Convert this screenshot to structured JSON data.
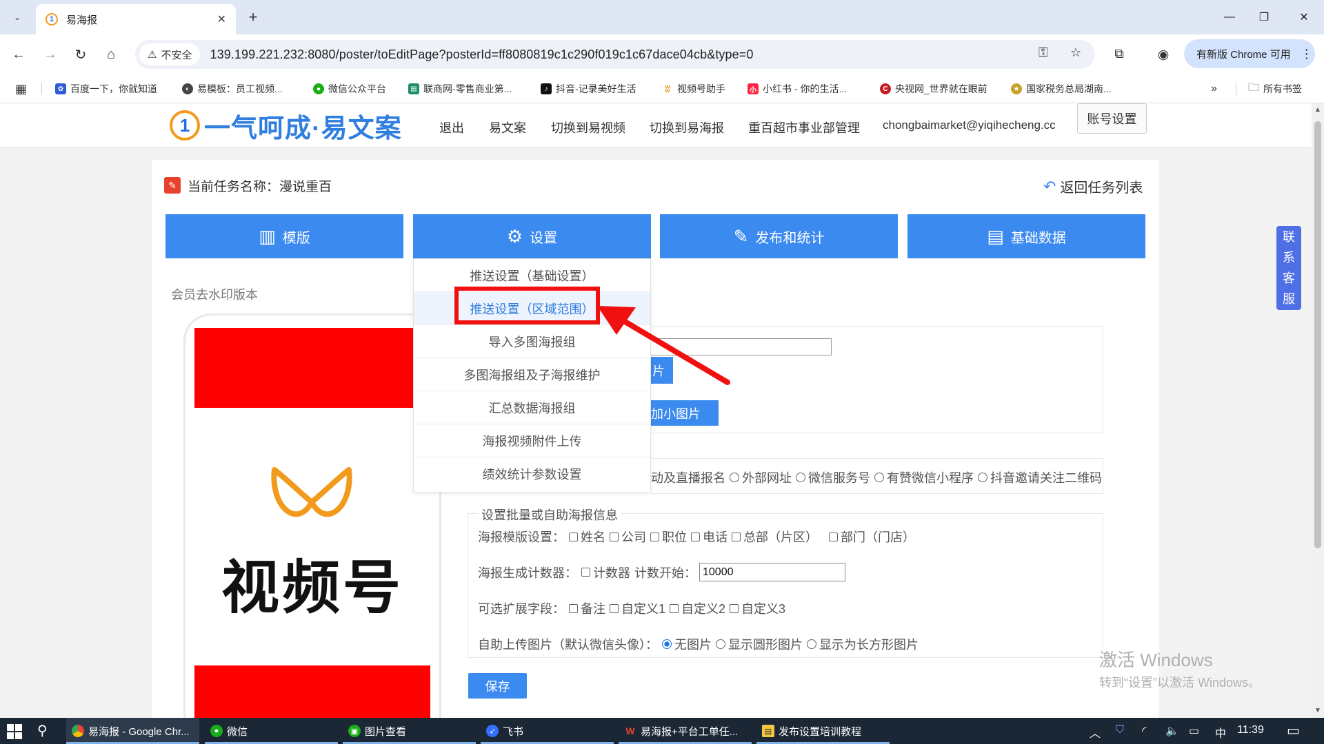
{
  "browser": {
    "tab_title": "易海报",
    "tab_favicon": "1",
    "url_security": "不安全",
    "url": "139.199.221.232:8080/poster/toEditPage?posterId=ff8080819c1c290f019c1c67dace04cb&type=0",
    "update_label": "有新版 Chrome 可用",
    "bookmarks": [
      {
        "label": "百度一下，你就知道",
        "color": "#2f5bd7",
        "icon": "paw-icon"
      },
      {
        "label": "易模板：员工视频...",
        "color": "#444",
        "icon": "globe-icon"
      },
      {
        "label": "微信公众平台",
        "color": "#1aad19",
        "icon": "wechat-icon"
      },
      {
        "label": "联商网-零售商业第...",
        "color": "#1c8c6a",
        "icon": "news-icon"
      },
      {
        "label": "抖音-记录美好生活",
        "color": "#111",
        "icon": "tiktok-icon"
      },
      {
        "label": "视频号助手",
        "color": "#f29a1c",
        "icon": "channels-icon"
      },
      {
        "label": "小红书 - 你的生活...",
        "color": "#ff2442",
        "icon": "xiaohongshu-icon"
      },
      {
        "label": "央视网_世界就在眼前",
        "color": "#c81d25",
        "icon": "cctv-icon"
      },
      {
        "label": "国家税务总局湖南...",
        "color": "#c8a02a",
        "icon": "emblem-icon"
      }
    ],
    "all_bookmarks": "所有书签"
  },
  "header": {
    "logo_text": "一气呵成·易文案",
    "nav": [
      "退出",
      "易文案",
      "切换到易视频",
      "切换到易海报",
      "重百超市事业部管理",
      "chongbaimarket@yiqihecheng.cc"
    ],
    "account_settings": "账号设置"
  },
  "task": {
    "label": "当前任务名称：漫说重百",
    "back": "返回任务列表"
  },
  "main_tabs": [
    {
      "label": "模版",
      "icon": "layout-icon"
    },
    {
      "label": "设置",
      "icon": "gear-icon"
    },
    {
      "label": "发布和统计",
      "icon": "edit-icon"
    },
    {
      "label": "基础数据",
      "icon": "data-icon"
    }
  ],
  "settings_menu": [
    "推送设置（基础设置）",
    "推送设置（区域范围）",
    "导入多图海报组",
    "多图海报组及子海报维护",
    "汇总数据海报组",
    "海报视频附件上传",
    "绩效统计参数设置"
  ],
  "member_note": "会员去水印版本",
  "poster": {
    "brand_text": "视频号",
    "accent": "#ff0000"
  },
  "form": {
    "partial_btn_a": "片",
    "partial_btn_b": "加小图片",
    "link_options": [
      "动及直播报名",
      "外部网址",
      "微信服务号",
      "有赞微信小程序",
      "抖音邀请关注二维码"
    ],
    "batch_legend": "设置批量或自助海报信息",
    "template_label": "海报模版设置：",
    "template_fields": [
      "姓名",
      "公司",
      "职位",
      "电话",
      "总部（片区）",
      "部门（门店）"
    ],
    "counter_label": "海报生成计数器：",
    "counter_option": "计数器",
    "counter_start_label": "计数开始：",
    "counter_start_value": "10000",
    "ext_label": "可选扩展字段：",
    "ext_fields": [
      "备注",
      "自定义1",
      "自定义2",
      "自定义3"
    ],
    "upload_label": "自助上传图片（默认微信头像）：",
    "upload_options": [
      "无图片",
      "显示圆形图片",
      "显示为长方形图片"
    ],
    "save": "保存"
  },
  "contact": [
    "联",
    "系",
    "客",
    "服"
  ],
  "watermark": {
    "line1": "激活 Windows",
    "line2": "转到“设置”以激活 Windows。"
  },
  "taskbar": {
    "items": [
      "易海报 - Google Chr...",
      "微信",
      "图片查看",
      "飞书",
      "易海报+平台工单任...",
      "发布设置培训教程"
    ],
    "ime": "中",
    "time": "11:39"
  }
}
